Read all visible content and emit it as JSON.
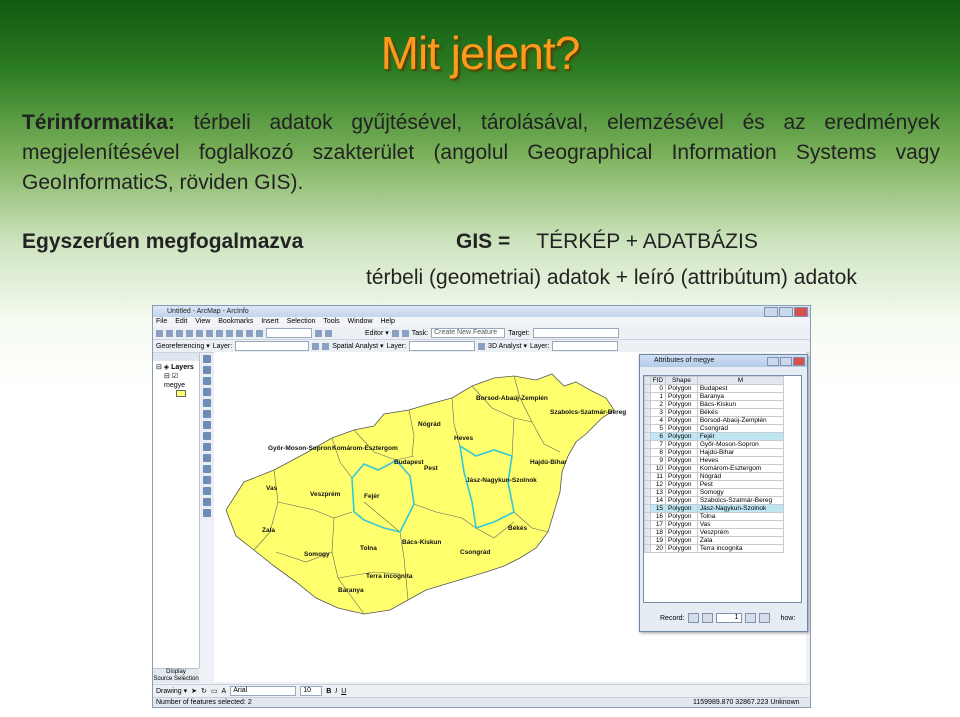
{
  "slide": {
    "title": "Mit jelent?",
    "intro_bold": "Térinformatika:",
    "intro_text": " térbeli adatok gyűjtésével, tárolásával, elemzésével és az eredmények megjelenítésével foglalkozó szakterület (angolul Geographical Information Systems vagy GeoInformaticS, röviden GIS).",
    "simply_label": "Egyszerűen megfogalmazva",
    "gis_label": "GIS =",
    "gis_formula": "TÉRKÉP + ADATBÁZIS",
    "formula_line2": "térbeli (geometriai) adatok + leíró (attribútum) adatok"
  },
  "arcmap": {
    "window_title": "Untitled - ArcMap - ArcInfo",
    "menu": [
      "File",
      "Edit",
      "View",
      "Bookmarks",
      "Insert",
      "Selection",
      "Tools",
      "Window",
      "Help"
    ],
    "toolbar_editor": "Editor ▾",
    "toolbar_task_label": "Task:",
    "toolbar_task_value": "Create New Feature",
    "toolbar_target_label": "Target:",
    "toolbar_georef": "Georeferencing ▾",
    "toolbar_layer_label": "Layer:",
    "toolbar_spatial": "Spatial Analyst ▾",
    "toolbar_3d": "3D Analyst ▾",
    "toc_layers": "Layers",
    "toc_layer_name": "megye",
    "toc_tabs": [
      "Display",
      "Source",
      "Selection"
    ],
    "drawing_label": "Drawing ▾",
    "font_name": "Arial",
    "font_size": "10",
    "status_left": "Number of features selected: 2",
    "status_right": "1159989.870  32867.223 Unknown Units"
  },
  "attr_table": {
    "title": "Attributes of megye",
    "headers": [
      "FID",
      "Shape",
      "M"
    ],
    "rows": [
      [
        "0",
        "Polygon",
        "Budapest"
      ],
      [
        "1",
        "Polygon",
        "Baranya"
      ],
      [
        "2",
        "Polygon",
        "Bács-Kiskun"
      ],
      [
        "3",
        "Polygon",
        "Békés"
      ],
      [
        "4",
        "Polygon",
        "Borsod-Abaúj-Zemplén"
      ],
      [
        "5",
        "Polygon",
        "Csongrád"
      ],
      [
        "6",
        "Polygon",
        "Fejér"
      ],
      [
        "7",
        "Polygon",
        "Győr-Moson-Sopron"
      ],
      [
        "8",
        "Polygon",
        "Hajdú-Bihar"
      ],
      [
        "9",
        "Polygon",
        "Heves"
      ],
      [
        "10",
        "Polygon",
        "Komárom-Esztergom"
      ],
      [
        "11",
        "Polygon",
        "Nógrád"
      ],
      [
        "12",
        "Polygon",
        "Pest"
      ],
      [
        "13",
        "Polygon",
        "Somogy"
      ],
      [
        "14",
        "Polygon",
        "Szabolcs-Szatmár-Bereg"
      ],
      [
        "15",
        "Polygon",
        "Jász-Nagykun-Szolnok"
      ],
      [
        "16",
        "Polygon",
        "Tolna"
      ],
      [
        "17",
        "Polygon",
        "Vas"
      ],
      [
        "18",
        "Polygon",
        "Veszprém"
      ],
      [
        "19",
        "Polygon",
        "Zala"
      ],
      [
        "20",
        "Polygon",
        "Terra incognita"
      ]
    ],
    "selected_rows": [
      6,
      15
    ],
    "record_label": "Record:",
    "record_value": "1",
    "show_label": "how:"
  },
  "map_labels": [
    "Borsod-Abaúj-Zemplén",
    "Szabolcs-Szatmár-Bereg",
    "Nógrád",
    "Heves",
    "Győr-Moson-Sopron",
    "Komárom-Esztergom",
    "Budapest",
    "Pest",
    "Hajdú-Bihar",
    "Jász-Nagykun-Szolnok",
    "Vas",
    "Veszprém",
    "Fejér",
    "Zala",
    "Békés",
    "Somogy",
    "Tolna",
    "Bács-Kiskun",
    "Csongrád",
    "Baranya",
    "Terra incognita"
  ],
  "colors": {
    "county_fill": "#ffff6e",
    "selected_outline": "#35c6d8",
    "title": "#ff9a1c"
  }
}
